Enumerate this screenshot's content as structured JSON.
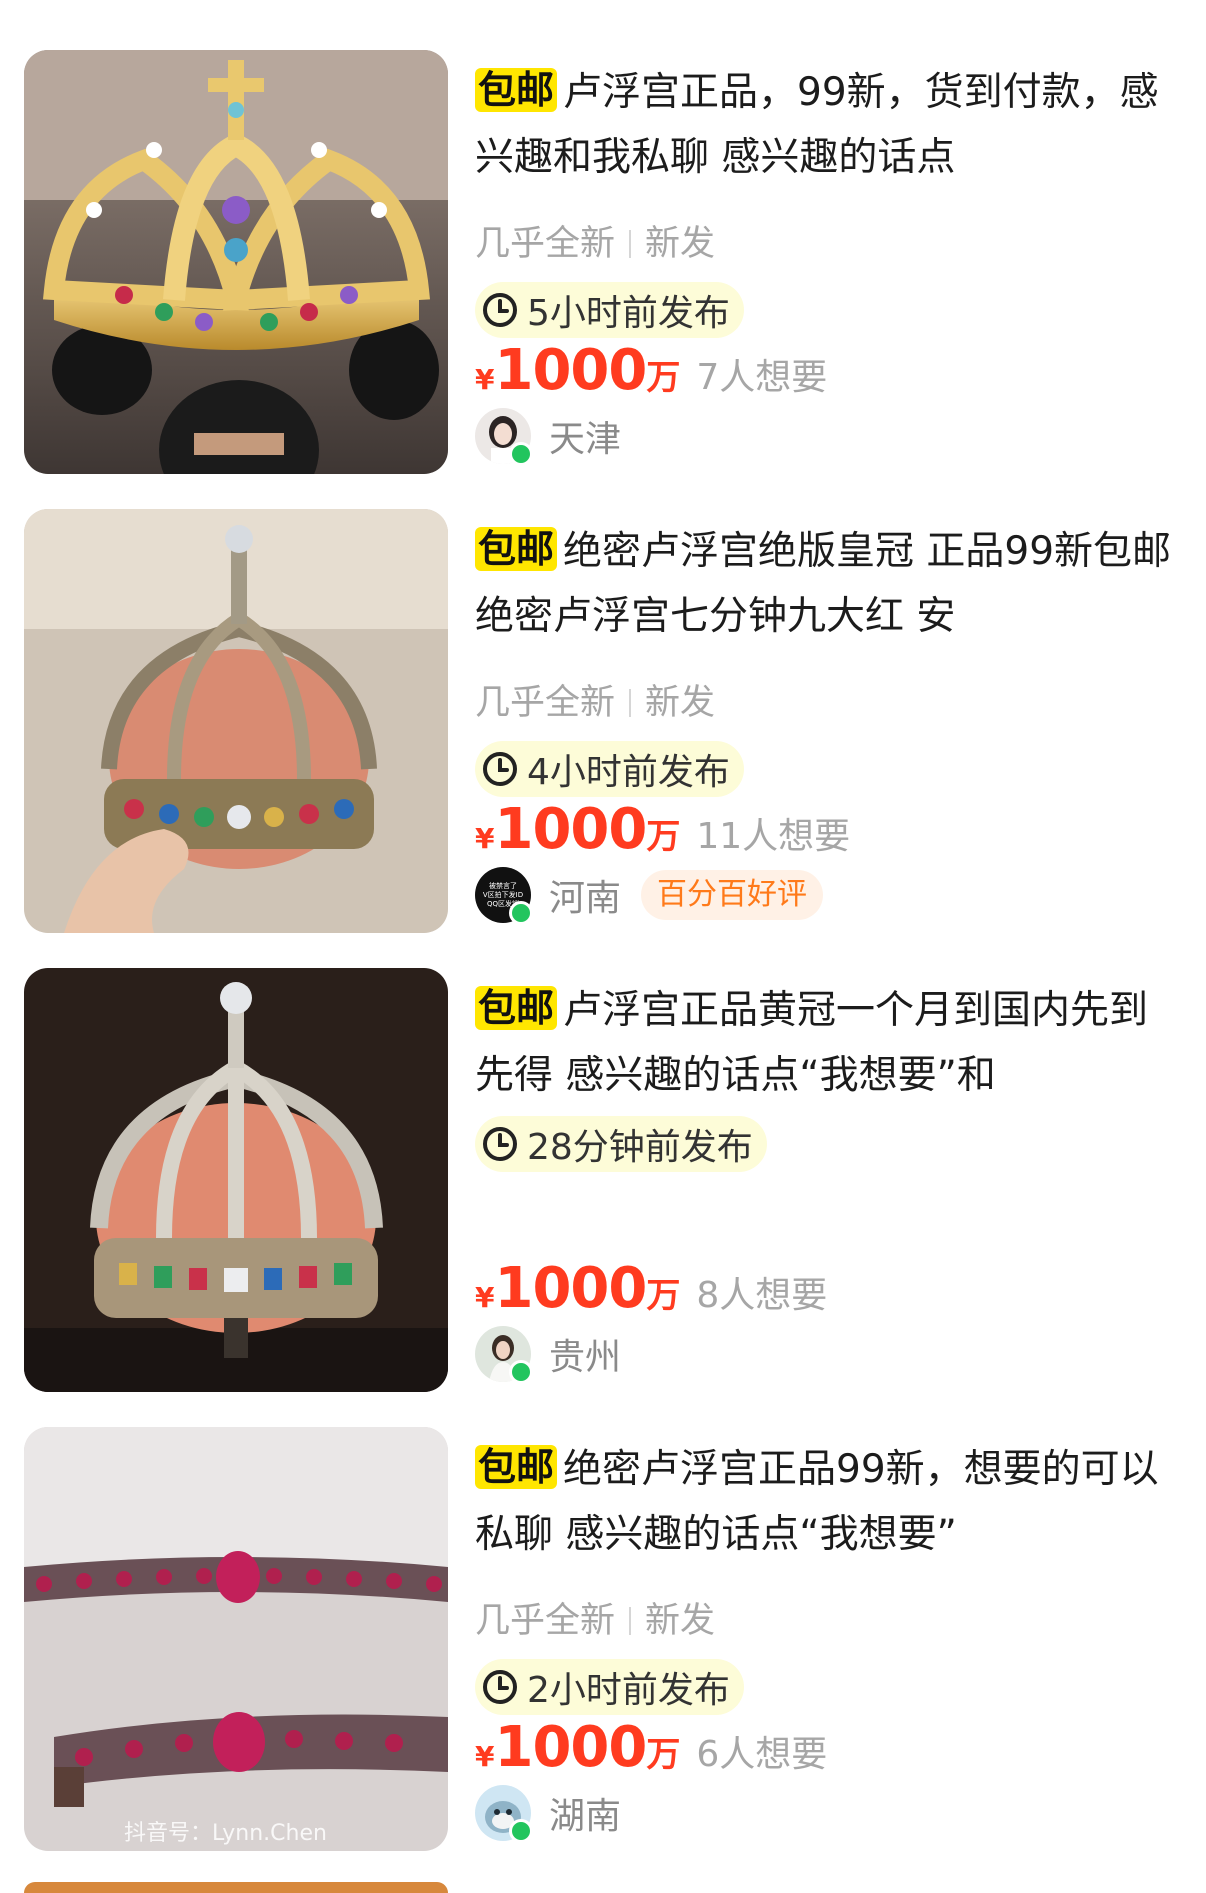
{
  "listings": [
    {
      "badge": "包邮",
      "title": "卢浮宫正品，99新，货到付款，感兴趣和我私聊 感兴趣的话点",
      "condition": "几乎全新",
      "shipping": "新发",
      "posted": "5小时前发布",
      "currency": "¥",
      "price": "1000",
      "unit": "万",
      "wants": "7人想要",
      "city": "天津",
      "rating": "",
      "image": "gold-crown-held-by-masked-hands"
    },
    {
      "badge": "包邮",
      "title": "绝密卢浮宫绝版皇冠 正品99新包邮 绝密卢浮宫七分钟九大红 安",
      "condition": "几乎全新",
      "shipping": "新发",
      "posted": "4小时前发布",
      "currency": "¥",
      "price": "1000",
      "unit": "万",
      "wants": "11人想要",
      "city": "河南",
      "rating": "百分百好评",
      "avatar_text": [
        "被禁言了",
        "V区拍下发ID",
        "QQ区发销"
      ],
      "image": "jeweled-crown-in-hand"
    },
    {
      "badge": "包邮",
      "title": "卢浮宫正品黄冠一个月到国内先到先得 感兴趣的话点“我想要”和",
      "posted": "28分钟前发布",
      "currency": "¥",
      "price": "1000",
      "unit": "万",
      "wants": "8人想要",
      "city": "贵州",
      "rating": "",
      "image": "jeweled-crown-on-display"
    },
    {
      "badge": "包邮",
      "title": "绝密卢浮宫正品99新，想要的可以私聊 感兴趣的话点“我想要”",
      "condition": "几乎全新",
      "shipping": "新发",
      "posted": "2小时前发布",
      "currency": "¥",
      "price": "1000",
      "unit": "万",
      "wants": "6人想要",
      "city": "湖南",
      "rating": "",
      "watermark": "抖音号：Lynn.Chen",
      "image": "ruby-diamond-bracelets"
    }
  ],
  "colors": {
    "price": "#ff3b1f",
    "badge_bg": "#ffe600",
    "time_bg": "#fdfcd8",
    "online": "#22c55e",
    "rating_text": "#ff7a1a"
  }
}
